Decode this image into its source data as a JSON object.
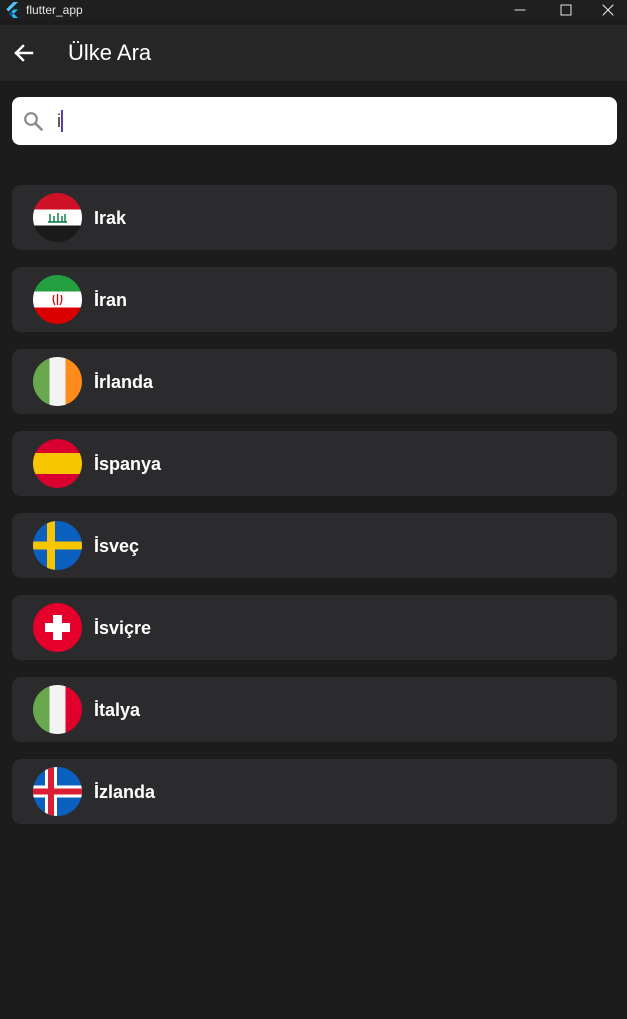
{
  "window": {
    "title": "flutter_app"
  },
  "appbar": {
    "title": "Ülke Ara"
  },
  "search": {
    "value": "i",
    "placeholder": ""
  },
  "colors": {
    "background": "#1c1c1c",
    "card": "#2b2b2d",
    "appbar": "#262626",
    "caret": "#5b3fa6"
  },
  "countries": [
    {
      "name": "Irak",
      "flag": "iraq-flag-icon"
    },
    {
      "name": "İran",
      "flag": "iran-flag-icon"
    },
    {
      "name": "İrlanda",
      "flag": "ireland-flag-icon"
    },
    {
      "name": "İspanya",
      "flag": "spain-flag-icon"
    },
    {
      "name": "İsveç",
      "flag": "sweden-flag-icon"
    },
    {
      "name": "İsviçre",
      "flag": "switzerland-flag-icon"
    },
    {
      "name": "İtalya",
      "flag": "italy-flag-icon"
    },
    {
      "name": "İzlanda",
      "flag": "iceland-flag-icon"
    }
  ]
}
